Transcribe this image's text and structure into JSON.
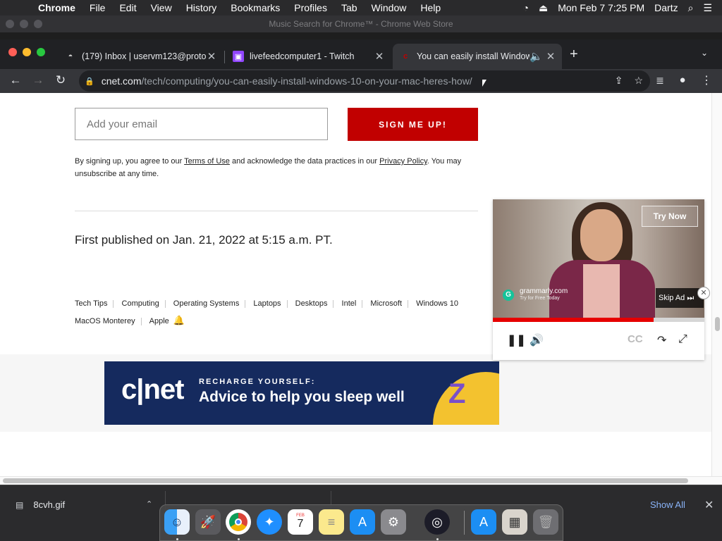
{
  "menubar": {
    "app": "Chrome",
    "items": [
      "File",
      "Edit",
      "View",
      "History",
      "Bookmarks",
      "Profiles",
      "Tab",
      "Window",
      "Help"
    ],
    "datetime": "Mon Feb 7  7:25 PM",
    "user": "Dartz"
  },
  "window": {
    "title": "Music Search for Chrome™ - Chrome Web Store"
  },
  "tabs": [
    {
      "title": "(179) Inbox | uservm123@proto",
      "icon": "mail-icon"
    },
    {
      "title": "livefeedcomputer1 - Twitch",
      "icon": "twitch-icon"
    },
    {
      "title": "You can easily install Windows",
      "icon": "cnet-icon",
      "active": true
    }
  ],
  "toolbar": {
    "url_host": "cnet.com",
    "url_path": "/tech/computing/you-can-easily-install-windows-10-on-your-mac-heres-how/"
  },
  "newsletter": {
    "email_placeholder": "Add your email",
    "signup_label": "SIGN ME UP!",
    "legal_before": "By signing up, you agree to our ",
    "terms_link": "Terms of Use",
    "legal_middle": " and acknowledge the data practices in our ",
    "privacy_link": "Privacy Policy",
    "legal_after": ". You may unsubscribe at any time."
  },
  "article": {
    "published": "First published on Jan. 21, 2022 at 5:15 a.m. PT.",
    "tags": [
      "Tech Tips",
      "Computing",
      "Operating Systems",
      "Laptops",
      "Desktops",
      "Intel",
      "Microsoft",
      "Windows 10",
      "MacOS Monterey",
      "Apple"
    ]
  },
  "banner": {
    "logo": "c|net",
    "kicker": "RECHARGE YOURSELF:",
    "headline": "Advice to help you sleep well",
    "z_glyph": "Z"
  },
  "video_ad": {
    "try_now": "Try Now",
    "skip_ad": "Skip Ad",
    "advertiser": "grammarly.com",
    "advertiser_sub": "Try for Free Today",
    "progress": 0.76,
    "cc": "CC"
  },
  "downloads": {
    "file": "8cvh.gif",
    "show_all": "Show All"
  },
  "colors": {
    "signup_red": "#c10000",
    "banner_navy": "#152a5e",
    "ad_progress": "#e60000",
    "link_blue": "#8ab4f8"
  }
}
